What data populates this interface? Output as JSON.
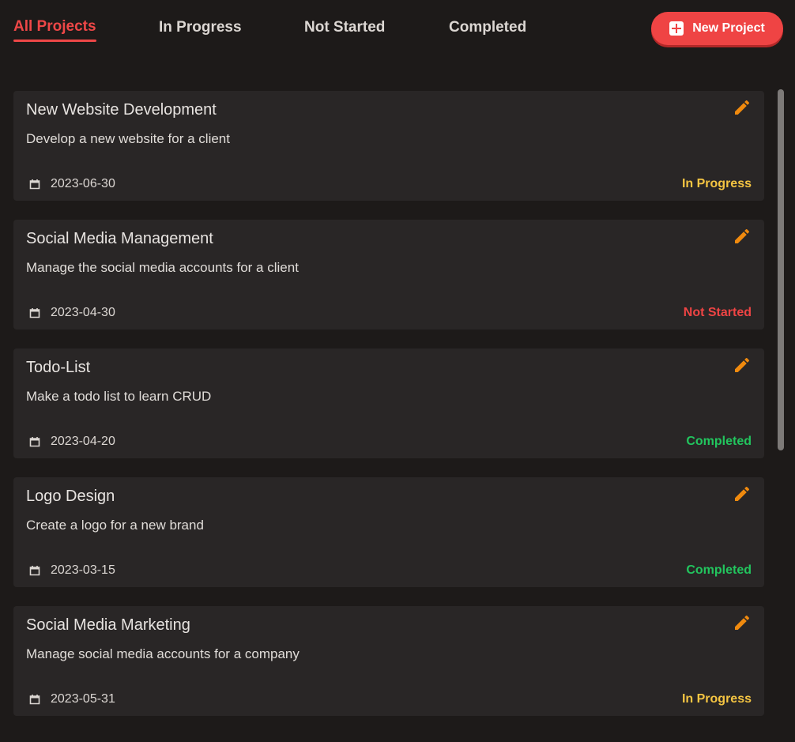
{
  "tabs": [
    {
      "label": "All Projects",
      "active": true
    },
    {
      "label": "In Progress",
      "active": false
    },
    {
      "label": "Not Started",
      "active": false
    },
    {
      "label": "Completed",
      "active": false
    }
  ],
  "new_project_button": {
    "label": "New Project",
    "icon": "plus-square-icon"
  },
  "colors": {
    "accent": "#ef4444",
    "in_progress": "#f5c542",
    "not_started": "#ef4444",
    "completed": "#22c55e",
    "edit_icon": "#f08a0e"
  },
  "projects": [
    {
      "title": "New Website Development",
      "description": "Develop a new website for a client",
      "date": "2023-06-30",
      "status": "In Progress"
    },
    {
      "title": "Social Media Management",
      "description": "Manage the social media accounts for a client",
      "date": "2023-04-30",
      "status": "Not Started"
    },
    {
      "title": "Todo-List",
      "description": "Make a todo list to learn CRUD",
      "date": "2023-04-20",
      "status": "Completed"
    },
    {
      "title": "Logo Design",
      "description": "Create a logo for a new brand",
      "date": "2023-03-15",
      "status": "Completed"
    },
    {
      "title": "Social Media Marketing",
      "description": "Manage social media accounts for a company",
      "date": "2023-05-31",
      "status": "In Progress"
    }
  ]
}
